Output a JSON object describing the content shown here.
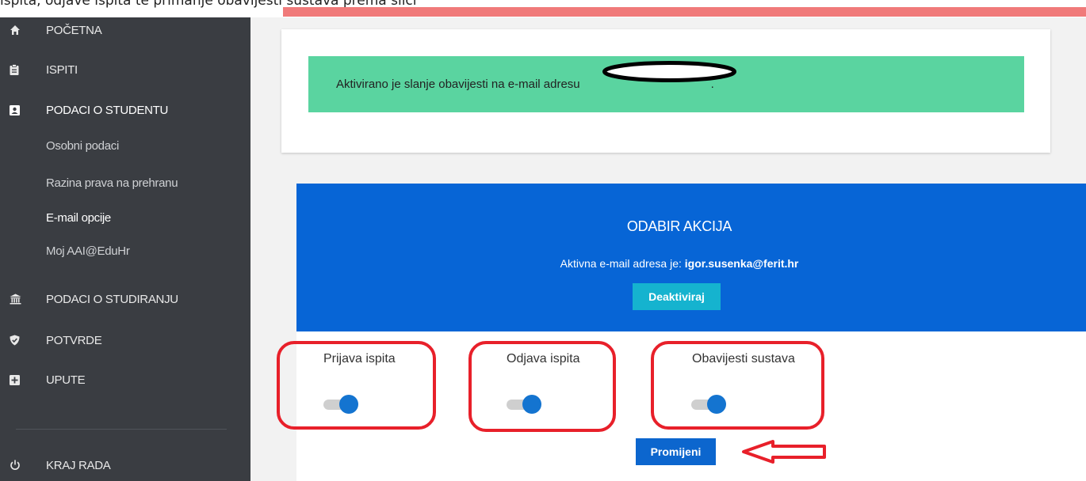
{
  "header_text": "ispita, odjave ispita te primanje obavijesti sustava prema slici",
  "sidebar": {
    "items": [
      {
        "label": "POČETNA",
        "icon": "home-icon"
      },
      {
        "label": "ISPITI",
        "icon": "clipboard-icon"
      },
      {
        "label": "PODACI O STUDENTU",
        "icon": "id-card-icon"
      },
      {
        "label": "PODACI O STUDIRANJU",
        "icon": "university-icon"
      },
      {
        "label": "POTVRDE",
        "icon": "shield-check-icon"
      },
      {
        "label": "UPUTE",
        "icon": "plus-square-icon"
      },
      {
        "label": "KRAJ RADA",
        "icon": "power-icon"
      }
    ],
    "subitems": [
      {
        "label": "Osobni podaci"
      },
      {
        "label": "Razina prava na prehranu"
      },
      {
        "label": "E-mail opcije",
        "active": true
      },
      {
        "label": "Moj AAI@EduHr"
      }
    ]
  },
  "alert": {
    "message": "Aktivirano je slanje obavijesti na e-mail adresu",
    "suffix": "."
  },
  "actions": {
    "title": "ODABIR AKCIJA",
    "active_label": "Aktivna e-mail adresa je:",
    "email": "igor.susenka@ferit.hr",
    "deactivate_label": "Deaktiviraj",
    "toggles": [
      {
        "label": "Prijava ispita",
        "on": true
      },
      {
        "label": "Odjava ispita",
        "on": true
      },
      {
        "label": "Obavijesti sustava",
        "on": true
      }
    ],
    "submit_label": "Promijeni"
  },
  "colors": {
    "sidebar_bg": "#3a3d42",
    "alert_bg": "#5ad4a0",
    "action_header_bg": "#0765d6",
    "deactivate_button": "#15b3cf",
    "submit_button": "#0c66ce",
    "toggle_thumb": "#1474d0",
    "annotation_red": "#e8202a",
    "top_bar_red": "#f07a7a"
  }
}
